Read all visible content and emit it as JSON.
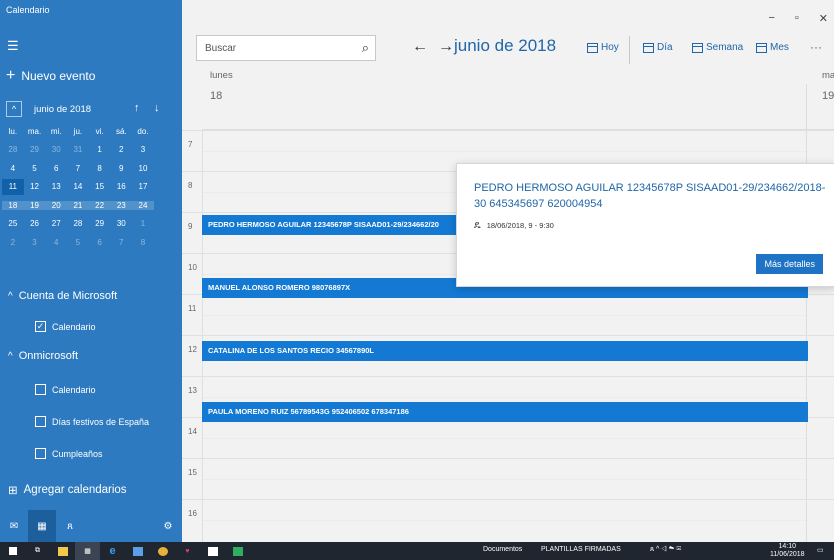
{
  "window": {
    "title": "Calendario",
    "controls": [
      "−",
      "▫",
      "✕"
    ]
  },
  "sidebar": {
    "new_event": "Nuevo evento",
    "mini_calendar": {
      "month": "junio de 2018",
      "weekdays": [
        "lu.",
        "ma.",
        "mi.",
        "ju.",
        "vi.",
        "sá.",
        "do."
      ],
      "weeks": [
        [
          "28",
          "29",
          "30",
          "31",
          "1",
          "2",
          "3"
        ],
        [
          "4",
          "5",
          "6",
          "7",
          "8",
          "9",
          "10"
        ],
        [
          "11",
          "12",
          "13",
          "14",
          "15",
          "16",
          "17"
        ],
        [
          "18",
          "19",
          "20",
          "21",
          "22",
          "23",
          "24"
        ],
        [
          "25",
          "26",
          "27",
          "28",
          "29",
          "30",
          "1"
        ],
        [
          "2",
          "3",
          "4",
          "5",
          "6",
          "7",
          "8"
        ]
      ]
    },
    "sections": [
      {
        "label": "Cuenta de Microsoft",
        "items": [
          {
            "label": "Calendario",
            "checked": true
          }
        ]
      },
      {
        "label": "Onmicrosoft",
        "items": [
          {
            "label": "Calendario",
            "checked": false
          },
          {
            "label": "Días festivos de España",
            "checked": false
          },
          {
            "label": "Cumpleaños",
            "checked": false
          }
        ]
      }
    ],
    "add_calendars": "Agregar calendarios"
  },
  "toolbar": {
    "search_placeholder": "Buscar",
    "month_title": "junio de 2018",
    "buttons": {
      "today": "Hoy",
      "day": "Día",
      "week": "Semana",
      "month": "Mes"
    },
    "more": "···"
  },
  "view": {
    "day_name": "lunes",
    "day_number": "18",
    "next_day_name": "ma",
    "next_day_number": "19",
    "hours": [
      "7",
      "8",
      "9",
      "10",
      "11",
      "12",
      "13",
      "14",
      "15",
      "16"
    ]
  },
  "events": [
    {
      "title": "PEDRO HERMOSO AGUILAR 12345678P SISAAD01-29/234662/2018-30 645345697 620004954",
      "short": "PEDRO HERMOSO AGUILAR 12345678P SISAAD01-29/234662/20"
    },
    {
      "title": "MANUEL ALONSO ROMERO 98076897X"
    },
    {
      "title": "CATALINA DE LOS SANTOS RECIO 34567890L"
    },
    {
      "title": "PAULA MORENO RUIZ 56789543G 952406502 678347186"
    }
  ],
  "popup": {
    "title": "PEDRO HERMOSO AGUILAR 12345678P SISAAD01-29/234662/2018-30 645345697 620004954",
    "datetime": "18/06/2018, 9 - 9:30",
    "details_button": "Más detalles"
  },
  "taskbar": {
    "documents": "Documentos",
    "folder": "PLANTILLAS FIRMADAS",
    "time": "14:10",
    "date": "11/06/2018"
  },
  "colors": {
    "sidebar": "#2d7ac0",
    "accent": "#2066a8",
    "event": "#1379d3",
    "taskbar": "#1f2630"
  }
}
